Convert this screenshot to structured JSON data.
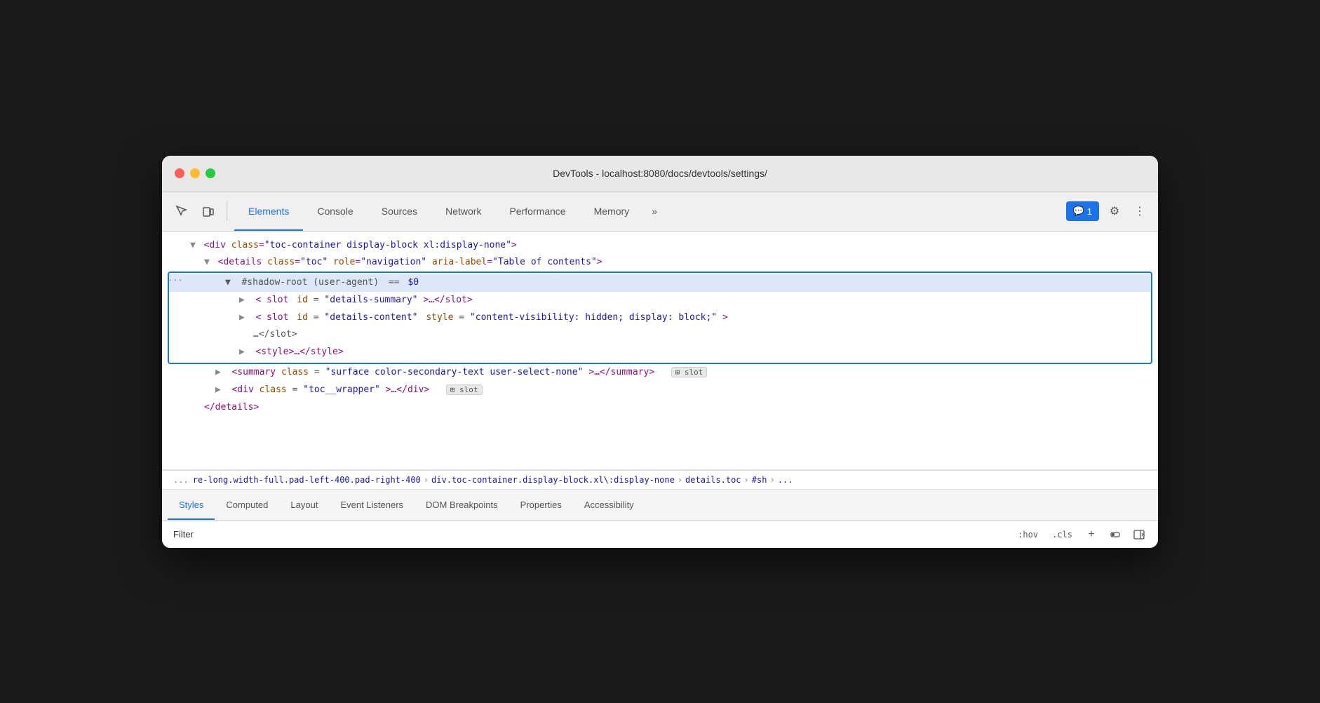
{
  "window": {
    "title": "DevTools - localhost:8080/docs/devtools/settings/"
  },
  "toolbar": {
    "tabs": [
      {
        "id": "elements",
        "label": "Elements",
        "active": true
      },
      {
        "id": "console",
        "label": "Console",
        "active": false
      },
      {
        "id": "sources",
        "label": "Sources",
        "active": false
      },
      {
        "id": "network",
        "label": "Network",
        "active": false
      },
      {
        "id": "performance",
        "label": "Performance",
        "active": false
      },
      {
        "id": "memory",
        "label": "Memory",
        "active": false
      }
    ],
    "more_tabs_icon": "»",
    "notification_icon": "💬",
    "notification_count": "1",
    "settings_icon": "⚙",
    "more_icon": "⋮"
  },
  "dom_tree": {
    "line1": "▼ <div class=\"toc-container display-block xl:display-none\">",
    "line2": "  ▼ <details class=\"toc\" role=\"navigation\" aria-label=\"Table of contents\">",
    "shadow_root_label": "▼ #shadow-root (user-agent)",
    "shadow_root_var": "== $0",
    "slot1": "  ▶ <slot id=\"details-summary\">…</slot>",
    "slot2_start": "  ▶ <slot id=\"details-content\" style=\"content-visibility: hidden; display: block;\">",
    "slot2_end": "    …</slot>",
    "style_tag": "  ▶ <style>…</style>",
    "summary_line": "  ▶ <summary class=\"surface color-secondary-text user-select-none\">…</summary>",
    "slot_badge1": "slot",
    "div_wrapper": "  ▶ <div class=\"toc__wrapper\">…</div>",
    "slot_badge2": "slot",
    "details_close": "  </details>",
    "dots": "..."
  },
  "breadcrumb": {
    "items": [
      "re-long.width-full.pad-left-400.pad-right-400",
      "div.toc-container.display-block.xl\\:display-none",
      "details.toc",
      "#sh",
      "..."
    ]
  },
  "bottom_panel": {
    "tabs": [
      {
        "id": "styles",
        "label": "Styles",
        "active": true
      },
      {
        "id": "computed",
        "label": "Computed",
        "active": false
      },
      {
        "id": "layout",
        "label": "Layout",
        "active": false
      },
      {
        "id": "event-listeners",
        "label": "Event Listeners",
        "active": false
      },
      {
        "id": "dom-breakpoints",
        "label": "DOM Breakpoints",
        "active": false
      },
      {
        "id": "properties",
        "label": "Properties",
        "active": false
      },
      {
        "id": "accessibility",
        "label": "Accessibility",
        "active": false
      }
    ]
  },
  "filter_bar": {
    "label": "Filter",
    "placeholder": "",
    "hov_btn": ":hov",
    "cls_btn": ".cls",
    "plus_btn": "+",
    "paint_icon": "🖌",
    "arrow_icon": "←"
  }
}
